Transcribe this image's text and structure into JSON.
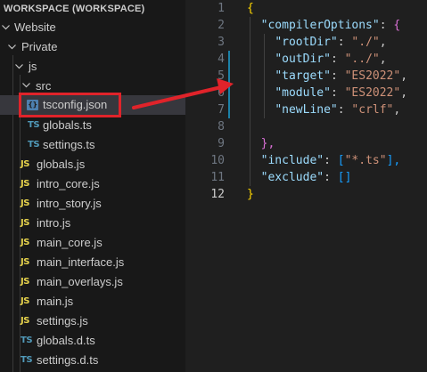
{
  "explorer": {
    "workspace_title": "WORKSPACE (WORKSPACE)",
    "folders": {
      "website": "Website",
      "private": "Private",
      "js": "js",
      "src": "src"
    },
    "files": [
      {
        "name": "tsconfig.json",
        "type": "json",
        "selected": true
      },
      {
        "name": "globals.ts",
        "type": "ts"
      },
      {
        "name": "settings.ts",
        "type": "ts"
      },
      {
        "name": "globals.js",
        "type": "js"
      },
      {
        "name": "intro_core.js",
        "type": "js"
      },
      {
        "name": "intro_story.js",
        "type": "js"
      },
      {
        "name": "intro.js",
        "type": "js"
      },
      {
        "name": "main_core.js",
        "type": "js"
      },
      {
        "name": "main_interface.js",
        "type": "js"
      },
      {
        "name": "main_overlays.js",
        "type": "js"
      },
      {
        "name": "main.js",
        "type": "js"
      },
      {
        "name": "settings.js",
        "type": "js"
      },
      {
        "name": "globals.d.ts",
        "type": "ts"
      },
      {
        "name": "settings.d.ts",
        "type": "ts"
      }
    ],
    "icon_labels": {
      "ts": "TS",
      "js": "JS",
      "json": "{}"
    }
  },
  "editor": {
    "line_numbers": [
      "1",
      "2",
      "3",
      "4",
      "5",
      "6",
      "7",
      "8",
      "9",
      "10",
      "11",
      "12"
    ],
    "active_line": 12,
    "code": {
      "l1_brace": "{",
      "l2_key": "\"compilerOptions\"",
      "l2_colon": ": ",
      "l2_brace": "{",
      "l3_key": "\"rootDir\"",
      "l3_val": "\"./\"",
      "l4_key": "\"outDir\"",
      "l4_val": "\"../\"",
      "l5_key": "\"target\"",
      "l5_val": "\"ES2022\"",
      "l6_key": "\"module\"",
      "l6_val": "\"ES2022\"",
      "l7_key": "\"newLine\"",
      "l7_val": "\"crlf\"",
      "l9_brace": "},",
      "l10_key": "\"include\"",
      "l10_open": "[",
      "l10_val": "\"*.ts\"",
      "l10_close": "],",
      "l11_key": "\"exclude\"",
      "l11_brackets": "[]",
      "l12_brace": "}",
      "colon": ": ",
      "comma": ","
    }
  },
  "colors": {
    "annotation": "#e0232a",
    "explorer_bg": "#181818",
    "editor_bg": "#1f1f1f"
  }
}
